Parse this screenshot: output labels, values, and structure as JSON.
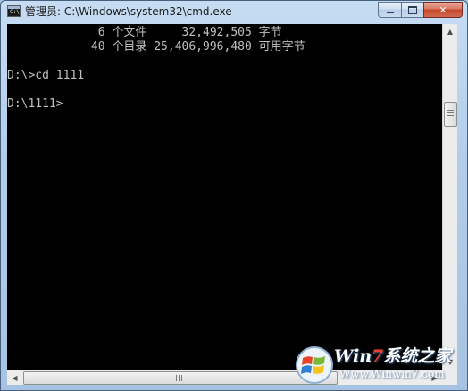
{
  "window": {
    "title": "管理员: C:\\Windows\\system32\\cmd.exe",
    "icon_label": "C:\\"
  },
  "caption_buttons": {
    "close_glyph": "✕"
  },
  "console": {
    "lines": [
      "             6 个文件     32,492,505 字节",
      "            40 个目录 25,406,996,480 可用字节",
      "",
      "D:\\>cd 1111",
      "",
      "D:\\1111>"
    ],
    "text_color": "#c0c0c0",
    "background": "#000000"
  },
  "scrollbars": {
    "up_arrow": "▲",
    "down_arrow": "▼",
    "left_arrow": "◀",
    "right_arrow": "▶"
  },
  "watermark": {
    "brand_prefix": "Win",
    "brand_seven": "7",
    "brand_suffix": "系统之家",
    "url": "Www.Winwin7.com"
  }
}
